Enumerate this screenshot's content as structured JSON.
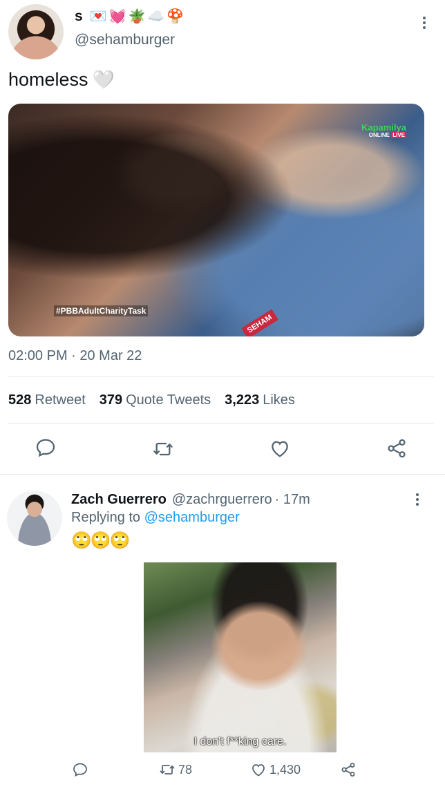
{
  "main_tweet": {
    "display_name": "s",
    "name_emojis": [
      "💌",
      "💓",
      "🪴",
      "☁️",
      "🍄"
    ],
    "handle": "@sehamburger",
    "text": "homeless",
    "text_emoji": "🤍",
    "media": {
      "hashtag_overlay": "#PBBAdultCharityTask",
      "channel_logo": "Kapamilya",
      "channel_sub": "ONLINE",
      "channel_live": "LIVE",
      "mic_label": "SEHAM"
    },
    "timestamp": "02:00 PM · 20 Mar 22",
    "stats": [
      {
        "count": "528",
        "label": "Retweet"
      },
      {
        "count": "379",
        "label": "Quote Tweets"
      },
      {
        "count": "3,223",
        "label": "Likes"
      }
    ]
  },
  "reply": {
    "display_name": "Zach Guerrero",
    "handle": "@zachrguerrero",
    "time": "· 17m",
    "replying_prefix": "Replying to",
    "replying_handle": "@sehamburger",
    "text": "🙄🙄🙄",
    "media_caption": "I don't f**king care.",
    "retweets": "78",
    "likes": "1,430"
  },
  "colors": {
    "text_primary": "#0f1419",
    "text_secondary": "#536471",
    "link": "#1d9bf0",
    "divider": "#e6e9ec"
  },
  "icons": [
    "more-vertical-icon",
    "reply-icon",
    "retweet-icon",
    "like-icon",
    "share-icon"
  ]
}
